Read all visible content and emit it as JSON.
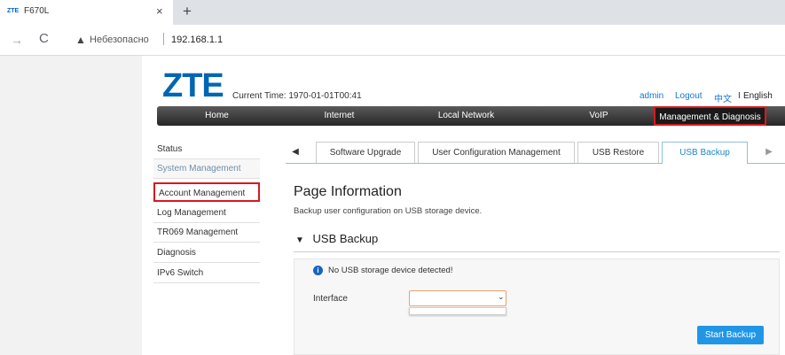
{
  "browser": {
    "tab_logo": "ZTE",
    "tab_title": "F670L",
    "tab_close": "×",
    "new_tab": "+",
    "back": "→",
    "reload": "C",
    "warning_icon": "▲",
    "insecure_label": "Небезопасно",
    "url": "192.168.1.1"
  },
  "header": {
    "logo": "ZTE",
    "current_time": "Current Time: 1970-01-01T00:41",
    "user": "admin",
    "logout": "Logout",
    "lang_zh": "中文",
    "lang_sep": "I",
    "lang_en": "English"
  },
  "menu": {
    "items": [
      "Home",
      "Internet",
      "Local Network",
      "VoIP",
      "Management & Diagnosis"
    ],
    "active": "Management & Diagnosis"
  },
  "sidebar": {
    "items": [
      "Status",
      "System Management",
      "Account Management",
      "Log Management",
      "TR069 Management",
      "Diagnosis",
      "IPv6 Switch"
    ]
  },
  "tabs": {
    "prev": "◀",
    "next": "▶",
    "items": [
      "Software Upgrade",
      "User Configuration Management",
      "USB Restore",
      "USB Backup"
    ],
    "active": "USB Backup"
  },
  "content": {
    "page_title": "Page Information",
    "page_desc": "Backup user configuration on USB storage device.",
    "section_toggle": "▼",
    "section_title": "USB Backup",
    "info_icon": "i",
    "info_text": "No USB storage device detected!",
    "interface_label": "Interface",
    "interface_value": "",
    "select_arrow": "⌄",
    "start_button": "Start Backup"
  },
  "colors": {
    "logo_blue": "#0066b3",
    "highlight_red": "#d71920",
    "tab_active_blue": "#1e88c8",
    "button_blue": "#2196e6"
  }
}
